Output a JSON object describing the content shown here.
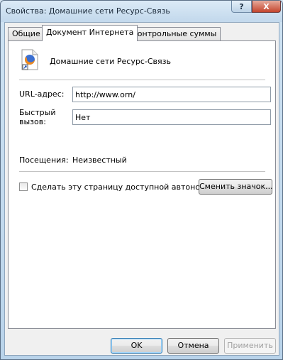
{
  "window": {
    "title": "Свойства: Домашние сети Ресурс-Связь",
    "help_glyph": "?",
    "close_glyph": "X"
  },
  "tabs": [
    {
      "label": "Общие"
    },
    {
      "label": "Документ Интернета",
      "active": true
    },
    {
      "label": "Контрольные суммы"
    }
  ],
  "document": {
    "name": "Домашние сети Ресурс-Связь",
    "icon": "firefox-shortcut-icon",
    "url_label": "URL-адрес:",
    "url_value": "http://www.orn/",
    "shortcut_label_line1": "Быстрый",
    "shortcut_label_line2": "вызов:",
    "shortcut_value": "Нет",
    "visits_label": "Посещения:",
    "visits_value": "Неизвестный",
    "offline_checkbox_label": "Сделать эту страницу доступной автономно",
    "offline_checked": false,
    "change_icon_button": "Сменить значок..."
  },
  "buttons": {
    "ok": "OK",
    "cancel": "Отмена",
    "apply": "Применить"
  }
}
